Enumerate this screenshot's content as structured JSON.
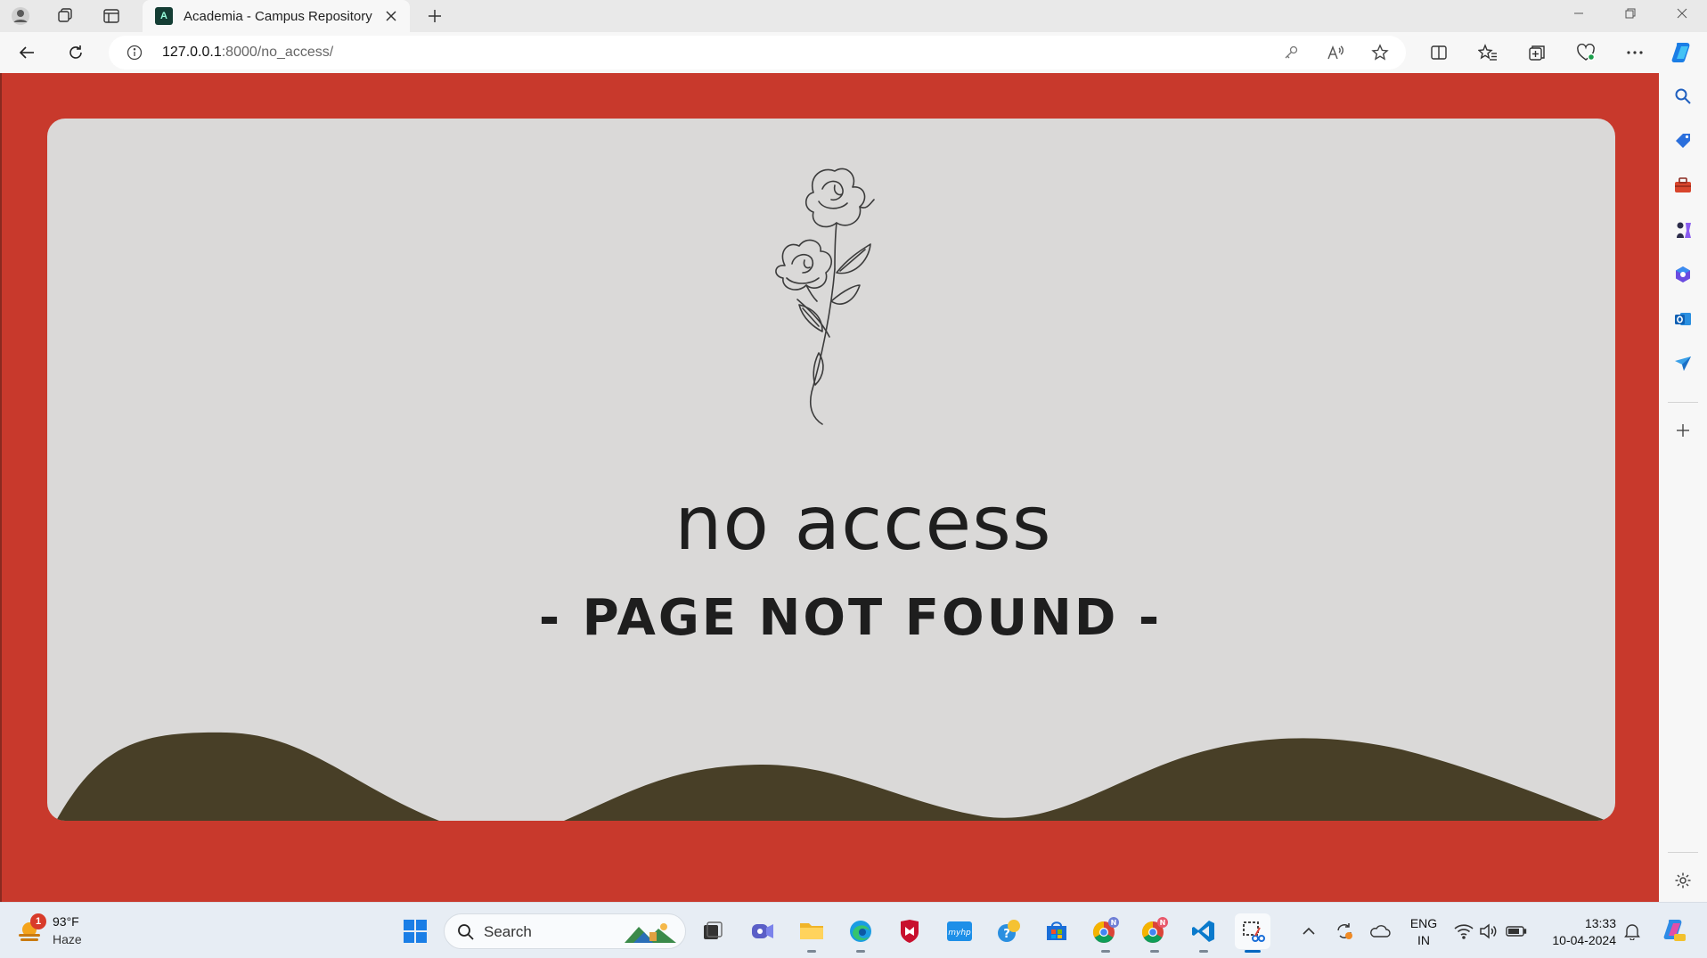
{
  "browser": {
    "tab_title": "Academia - Campus Repository",
    "url_host": "127.0.0.1",
    "url_path": ":8000/no_access/"
  },
  "page": {
    "heading": "no access",
    "subheading": "- PAGE NOT FOUND -",
    "colors": {
      "frame": "#c8392c",
      "card": "#dad9d8",
      "hills": "#483f27",
      "ink": "#1e1e1e"
    },
    "illustration": "rose-line-drawing"
  },
  "sidebar": {
    "items": [
      "search-icon",
      "shopping-tag-icon",
      "tools-icon",
      "chess-icon",
      "office-icon",
      "outlook-icon",
      "send-icon",
      "add-icon",
      "settings-icon"
    ]
  },
  "taskbar": {
    "weather": {
      "badge": "1",
      "temp": "93°F",
      "condition": "Haze"
    },
    "search_placeholder": "Search",
    "apps": [
      "start-icon",
      "task-view-icon",
      "teams-icon",
      "file-explorer-icon",
      "edge-icon",
      "mcafee-icon",
      "myhp-icon",
      "help-icon",
      "store-icon",
      "chrome-icon",
      "chrome-icon",
      "vscode-icon",
      "snipping-tool-icon"
    ],
    "tray": {
      "lang_line1": "ENG",
      "lang_line2": "IN",
      "time": "13:33",
      "date": "10-04-2024"
    }
  }
}
